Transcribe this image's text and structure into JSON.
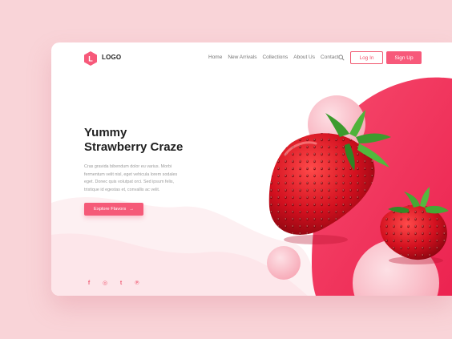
{
  "brand": {
    "logo_letter": "L",
    "logo_text": "LOGO"
  },
  "nav": [
    "Home",
    "New Arrivals",
    "Collections",
    "About Us",
    "Contact"
  ],
  "header": {
    "login_label": "Log In",
    "signup_label": "Sign Up"
  },
  "hero": {
    "title_line1": "Yummy",
    "title_line2": "Strawberry Craze",
    "description": "Cras gravida bibendum dolor eu varius. Morbi fermentum velit nisl, eget vehicula lorem sodales eget. Donec quis volutpat orci. Sed ipsum felis, tristique id egestas et, convallis ac velit.",
    "cta_label": "Explore Flavors",
    "cta_arrow": "→"
  },
  "social": [
    "f",
    "◎",
    "t",
    "℗"
  ],
  "colors": {
    "accent": "#f7597a",
    "background": "#f9d4d8",
    "blob": "#f23d60",
    "bubble": "#fbc6cf"
  },
  "icons": [
    "logo-hexagon-icon",
    "search-icon",
    "arrow-right-icon",
    "facebook-icon",
    "instagram-icon",
    "tumblr-icon",
    "pinterest-icon"
  ]
}
